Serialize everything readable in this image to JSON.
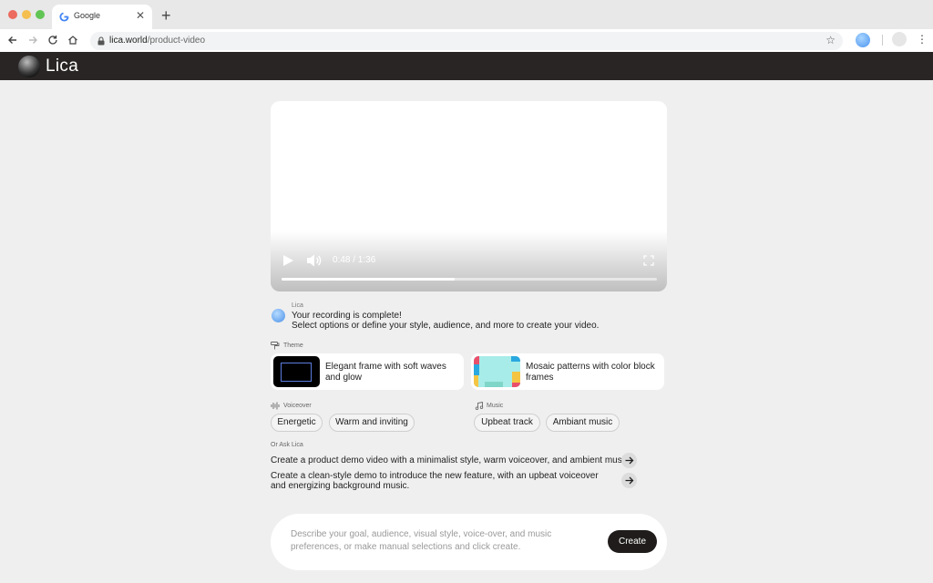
{
  "browser": {
    "tab_title": "Google",
    "tab_close": "✕",
    "new_tab": "+",
    "url_host": "lica.world",
    "url_path": "/product-video",
    "star": "☆",
    "menu": "⋮"
  },
  "app": {
    "logo_text": "Lica"
  },
  "video": {
    "time": "0:48 / 1:36",
    "progress_fraction": 0.46
  },
  "message": {
    "sender": "Lica",
    "line1": "Your recording is complete!",
    "line2": "Select options or define your style, audience, and more to create your video."
  },
  "theme": {
    "label": "Theme",
    "options": [
      {
        "label": "Elegant frame with soft waves and glow"
      },
      {
        "label": "Mosaic patterns with color block frames"
      }
    ]
  },
  "voiceover": {
    "label": "Voiceover",
    "options": [
      "Energetic",
      "Warm and inviting"
    ]
  },
  "music": {
    "label": "Music",
    "options": [
      "Upbeat track",
      "Ambiant music"
    ]
  },
  "ask": {
    "label": "Or Ask Lica",
    "suggestions": [
      "Create a product demo video with a minimalist style, warm voiceover, and ambient music.",
      "Create a clean-style demo to introduce the new feature, with an upbeat voiceover and energizing background music."
    ]
  },
  "prompt": {
    "placeholder": "Describe your goal, audience, visual style, voice-over, and music preferences, or make manual selections and click create.",
    "create_label": "Create"
  },
  "colors": {
    "header_bg": "#282524",
    "page_bg": "#efefef",
    "button_dark": "#1f1c1b"
  }
}
